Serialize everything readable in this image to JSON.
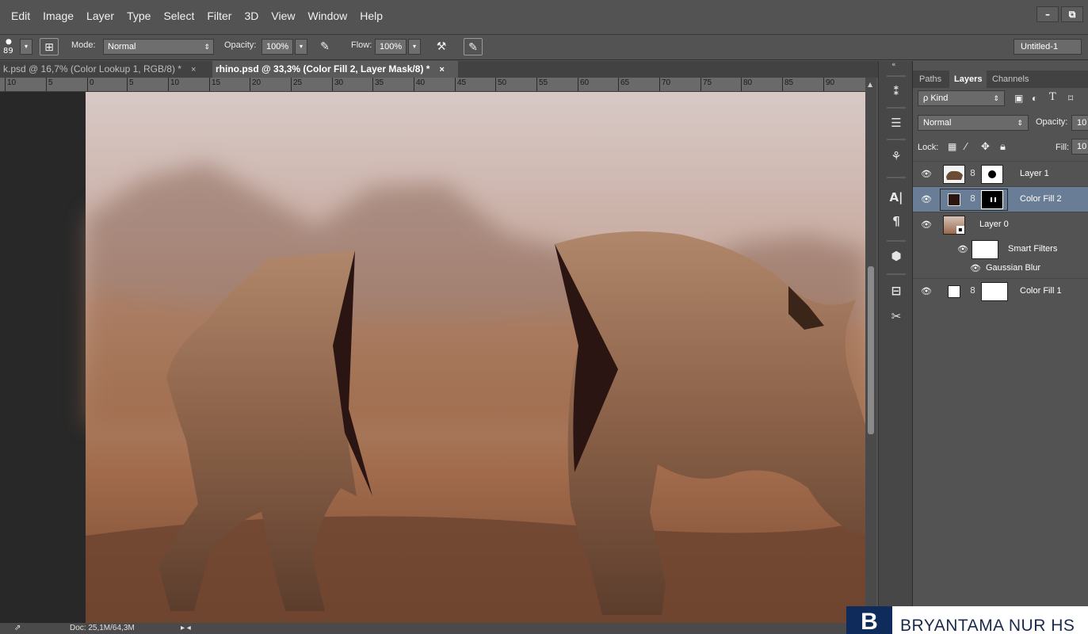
{
  "menu": [
    "Edit",
    "Image",
    "Layer",
    "Type",
    "Select",
    "Filter",
    "3D",
    "View",
    "Window",
    "Help"
  ],
  "window_controls": {
    "minimize": "–",
    "restore": "⧉"
  },
  "options": {
    "brush_size": "89",
    "mode_label": "Mode:",
    "mode_value": "Normal",
    "opacity_label": "Opacity:",
    "opacity_value": "100%",
    "flow_label": "Flow:",
    "flow_value": "100%",
    "workspace": "Untitled-1"
  },
  "doc_tabs": [
    {
      "label": "k.psd @ 16,7% (Color Lookup 1, RGB/8) *",
      "close": "×"
    },
    {
      "label": "rhino.psd @ 33,3% (Color Fill 2, Layer Mask/8) *",
      "close": "×"
    }
  ],
  "ruler_ticks": [
    "10",
    "5",
    "0",
    "5",
    "10",
    "15",
    "20",
    "25",
    "30",
    "35",
    "40",
    "45",
    "50",
    "55",
    "60",
    "65",
    "70",
    "75",
    "80",
    "85",
    "90"
  ],
  "status": {
    "doc": "Doc: 25,1M/64,3M"
  },
  "panel": {
    "collapse": "«",
    "tabs": [
      "Paths",
      "Layers",
      "Channels"
    ],
    "filter_kind": "ρ Kind",
    "blend_mode": "Normal",
    "opacity_label": "Opacity:",
    "opacity_value": "10",
    "lock_label": "Lock:",
    "fill_label": "Fill:",
    "fill_value": "10",
    "layers": [
      {
        "name": "Layer 1"
      },
      {
        "name": "Color Fill 2"
      },
      {
        "name": "Layer 0"
      },
      {
        "name": "Smart Filters"
      },
      {
        "name": "Gaussian Blur"
      },
      {
        "name": "Color Fill 1"
      }
    ]
  },
  "watermark": {
    "logo": "B",
    "text": "BRYANTAMA NUR HS"
  }
}
